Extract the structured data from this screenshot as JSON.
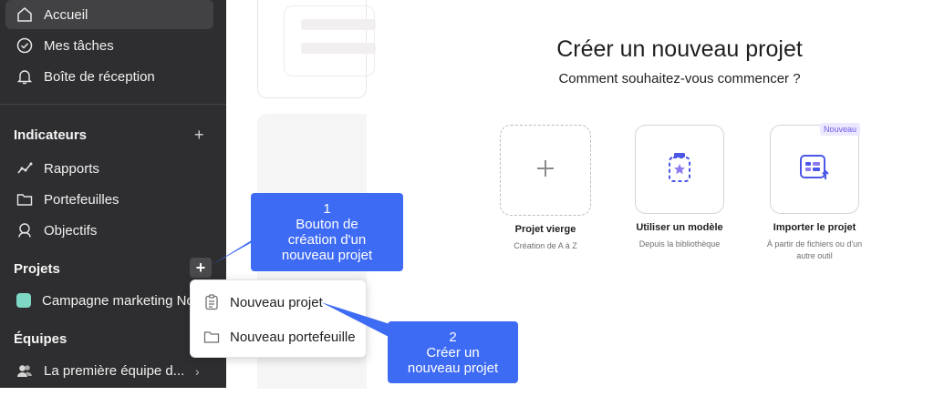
{
  "sidebar": {
    "nav": [
      {
        "label": "Accueil",
        "icon": "home-icon"
      },
      {
        "label": "Mes tâches",
        "icon": "check-circle-icon"
      },
      {
        "label": "Boîte de réception",
        "icon": "bell-icon"
      }
    ],
    "indicators": {
      "title": "Indicateurs",
      "items": [
        {
          "label": "Rapports",
          "icon": "chart-line-icon"
        },
        {
          "label": "Portefeuilles",
          "icon": "folder-icon"
        },
        {
          "label": "Objectifs",
          "icon": "person-icon"
        }
      ]
    },
    "projects": {
      "title": "Projets",
      "items": [
        {
          "label": "Campagne marketing No",
          "color": "#7fd8c6"
        }
      ]
    },
    "teams": {
      "title": "Équipes",
      "items": [
        {
          "label": "La première équipe d...",
          "icon": "team-icon"
        }
      ]
    }
  },
  "menu": {
    "items": [
      {
        "label": "Nouveau projet",
        "icon": "clipboard-icon"
      },
      {
        "label": "Nouveau portefeuille",
        "icon": "folder-icon"
      }
    ]
  },
  "callouts": [
    {
      "number": "1",
      "lines": [
        "Bouton de",
        "création d'un",
        "nouveau projet"
      ]
    },
    {
      "number": "2",
      "lines": [
        "Créer un",
        "nouveau projet"
      ]
    }
  ],
  "create": {
    "title": "Créer un nouveau projet",
    "subtitle": "Comment souhaitez-vous commencer ?",
    "options": [
      {
        "label": "Projet vierge",
        "desc": [
          "Création de A à Z"
        ],
        "icon": "plus-icon"
      },
      {
        "label": "Utiliser un modèle",
        "desc": [
          "Depuis la bibliothèque"
        ],
        "icon": "template-icon"
      },
      {
        "label": "Importer le projet",
        "desc": [
          "À partir de fichiers ou d'un",
          "autre outil"
        ],
        "icon": "import-icon",
        "badge": "Nouveau"
      }
    ]
  },
  "colors": {
    "sidebar": "#2e2e30",
    "callout": "#3e6bf3",
    "accent": "#6b5ce7"
  }
}
